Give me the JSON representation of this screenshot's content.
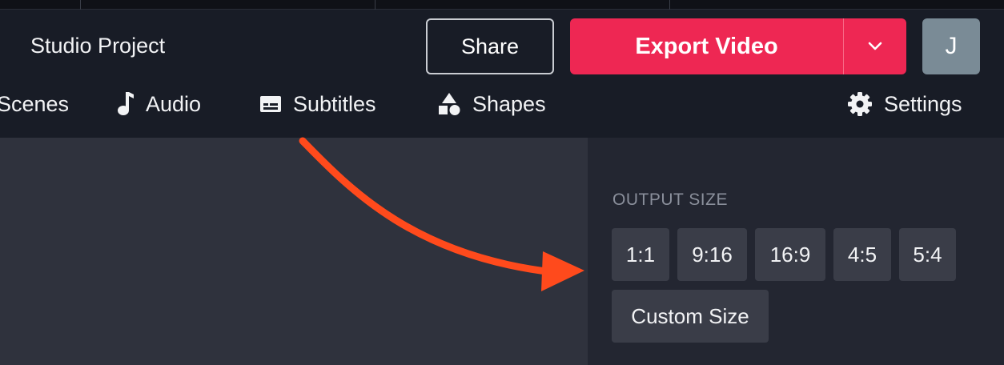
{
  "header": {
    "project_title": "Studio Project",
    "share_label": "Share",
    "export_label": "Export Video",
    "avatar_initial": "J"
  },
  "nav": {
    "items": [
      {
        "label": "Scenes",
        "icon": "none"
      },
      {
        "label": "Audio",
        "icon": "music-note-icon"
      },
      {
        "label": "Subtitles",
        "icon": "subtitles-icon"
      },
      {
        "label": "Shapes",
        "icon": "shapes-icon"
      },
      {
        "label": "Settings",
        "icon": "gear-icon"
      }
    ]
  },
  "output_size": {
    "heading": "OUTPUT SIZE",
    "options": [
      "1:1",
      "9:16",
      "16:9",
      "4:5",
      "5:4"
    ],
    "custom_label": "Custom Size"
  },
  "colors": {
    "accent": "#ee2753",
    "annotation_arrow": "#ff4a1c"
  }
}
